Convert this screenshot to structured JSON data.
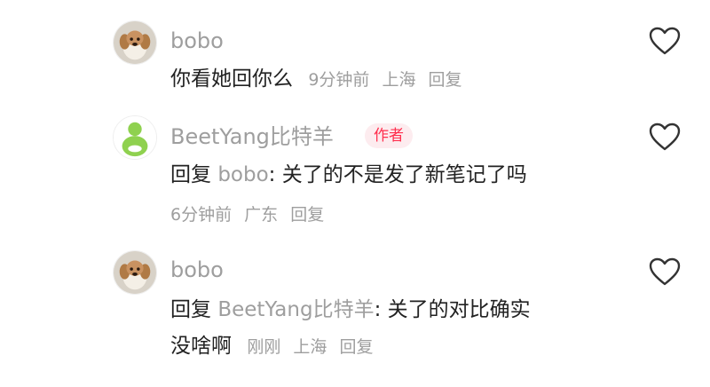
{
  "comments": [
    {
      "username": "bobo",
      "text": "你看她回你么",
      "time": "9分钟前",
      "location": "上海",
      "reply_label": "回复"
    },
    {
      "username": "BeetYang比特羊",
      "badge": "作者",
      "reply_prefix": "回复",
      "reply_to": "bobo",
      "text": ": 关了的不是发了新笔记了吗",
      "time": "6分钟前",
      "location": "广东",
      "reply_label": "回复"
    },
    {
      "username": "bobo",
      "reply_prefix": "回复",
      "reply_to": "BeetYang比特羊",
      "text_line1": ": 关了的对比确实",
      "text_line2": "没啥啊",
      "time": "刚刚",
      "location": "上海",
      "reply_label": "回复"
    }
  ],
  "colors": {
    "secondary_text": "#9e9e9e",
    "primary_text": "#222222",
    "author_badge": "#ff2e4d"
  },
  "icons": [
    "dog-avatar",
    "green-mascot-avatar",
    "heart-outline-icon"
  ]
}
